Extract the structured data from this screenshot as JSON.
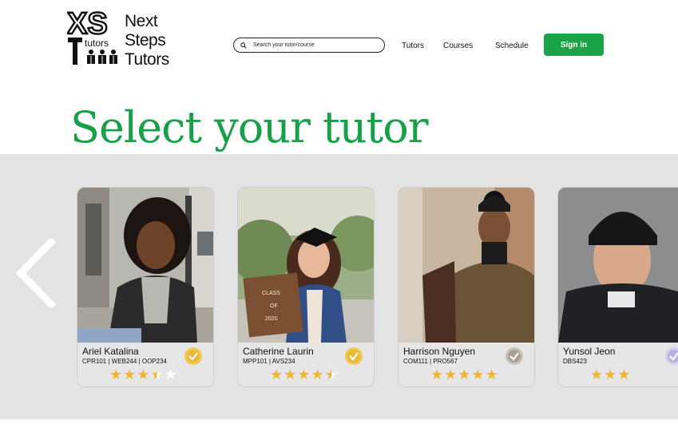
{
  "brand": {
    "name_lines": [
      "Next",
      "Steps",
      "Tutors"
    ],
    "logo_monogram": "XS",
    "logo_sub": "tutors"
  },
  "search": {
    "placeholder": "Search your tutor/course"
  },
  "nav": {
    "tutors": "Tutors",
    "courses": "Courses",
    "schedule": "Schedule",
    "signin": "Sign in"
  },
  "page_title": "Select your tutor",
  "colors": {
    "accent": "#17a047",
    "button": "#1aa447",
    "star": "#f4b724",
    "carousel_bg": "#e3e3e3"
  },
  "tutors": [
    {
      "name": "Ariel Katalina",
      "courses": "CPR101 | WEB244 | OOP234",
      "rating": 3.5,
      "max": 5,
      "badge": "gold"
    },
    {
      "name": "Catherine Laurin",
      "courses": "MPP101 | AVS234",
      "rating": 4.5,
      "max": 5,
      "badge": "gold"
    },
    {
      "name": "Harrison Nguyen",
      "courses": "COM111 | PRO567",
      "rating": 5,
      "max": 5,
      "badge": "silver"
    },
    {
      "name": "Yunsol Jeon",
      "courses": "DBS423",
      "rating": 3,
      "max": 3,
      "badge": "lavender"
    }
  ],
  "photo_text": {
    "board_line1": "CLASS",
    "board_line2": "OF",
    "board_line3": "2020"
  }
}
